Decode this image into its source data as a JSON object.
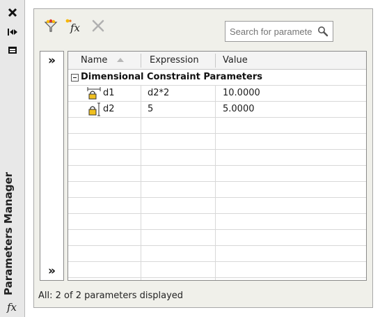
{
  "palette": {
    "panel_bg": "#f0f0ea",
    "strip_bg": "#e8e8e8",
    "grid_border": "#8a8a8a",
    "lock_fill": "#f0c020"
  },
  "side_strip": {
    "title": "Parameters Manager",
    "fx_symbol": "fx",
    "icons": [
      "close-icon",
      "auto-hide-icon",
      "properties-icon",
      "fx-icon"
    ]
  },
  "toolbar": {
    "icons": [
      "filter-icon",
      "new-user-parameter-icon",
      "delete-parameter-icon"
    ],
    "new_parameter_label": "fx",
    "search": {
      "placeholder": "Search for parameter"
    }
  },
  "expander": {
    "top_glyph": "»",
    "bottom_glyph": "»"
  },
  "table": {
    "columns": [
      "Name",
      "Expression",
      "Value"
    ],
    "sort_column": "Name",
    "group": {
      "label": "Dimensional Constraint Parameters",
      "expanded": true
    },
    "rows": [
      {
        "name": "d1",
        "expression": "d2*2",
        "value": "10.0000",
        "icon": "horizontal-dimension-lock-icon"
      },
      {
        "name": "d2",
        "expression": "5",
        "value": "5.0000",
        "icon": "vertical-dimension-lock-icon"
      }
    ]
  },
  "status": {
    "text": "All: 2 of 2 parameters displayed"
  }
}
